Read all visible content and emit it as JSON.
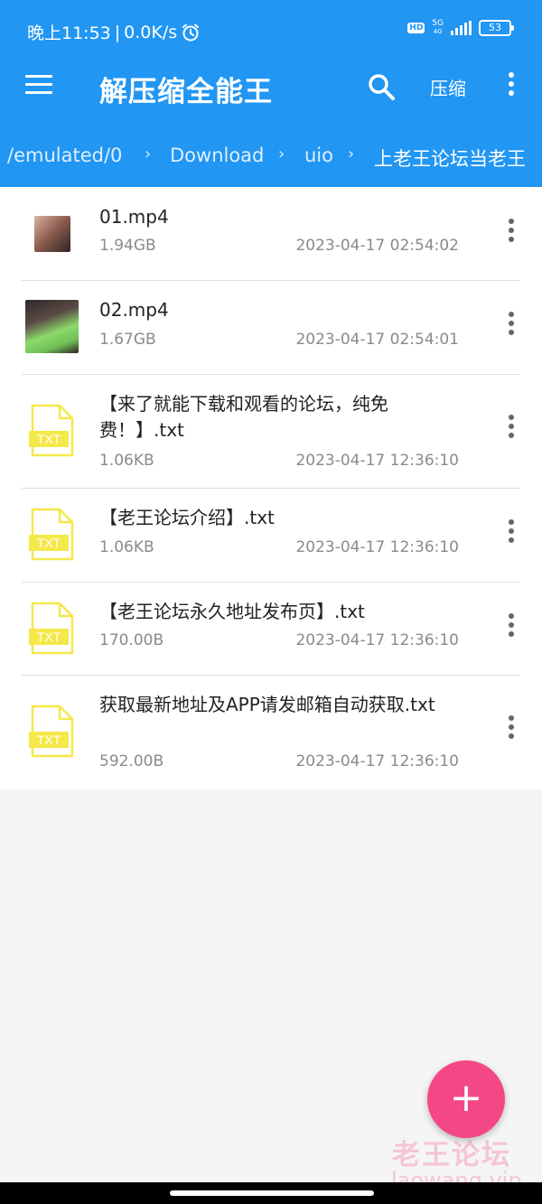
{
  "status_bar": {
    "time": "晚上11:53",
    "separator": "|",
    "network_speed": "0.0K/s",
    "hd_badge": "HD",
    "network_type": "5G",
    "network_sub": "4G",
    "battery": "53"
  },
  "toolbar": {
    "title": "解压缩全能王",
    "compress_label": "压缩"
  },
  "breadcrumb": {
    "items": [
      "/emulated/0",
      "Download",
      "uio",
      "上老王论坛当老王"
    ],
    "separator": "›"
  },
  "files": [
    {
      "name": "01.mp4",
      "size": "1.94GB",
      "date": "2023-04-17 02:54:02",
      "type": "video"
    },
    {
      "name": "02.mp4",
      "size": "1.67GB",
      "date": "2023-04-17 02:54:01",
      "type": "video"
    },
    {
      "name": "【来了就能下载和观看的论坛，纯免费！】.txt",
      "size": "1.06KB",
      "date": "2023-04-17 12:36:10",
      "type": "txt",
      "badge": "TXT"
    },
    {
      "name": "【老王论坛介绍】.txt",
      "size": "1.06KB",
      "date": "2023-04-17 12:36:10",
      "type": "txt",
      "badge": "TXT"
    },
    {
      "name": "【老王论坛永久地址发布页】.txt",
      "size": "170.00B",
      "date": "2023-04-17 12:36:10",
      "type": "txt",
      "badge": "TXT"
    },
    {
      "name": "获取最新地址及APP请发邮箱自动获取.txt",
      "size": "592.00B",
      "date": "2023-04-17 12:36:10",
      "type": "txt",
      "badge": "TXT"
    }
  ],
  "fab": {
    "label": "+"
  },
  "watermark": {
    "line1": "老王论坛",
    "line2": "laowang.vip"
  },
  "colors": {
    "primary": "#2196f3",
    "fab": "#f44785",
    "txt_icon": "#f5e84a"
  },
  "icons": {
    "menu": "menu-icon",
    "search": "search-icon",
    "more": "more-vert-icon",
    "alarm": "alarm-icon",
    "signal": "signal-icon",
    "battery": "battery-icon"
  }
}
